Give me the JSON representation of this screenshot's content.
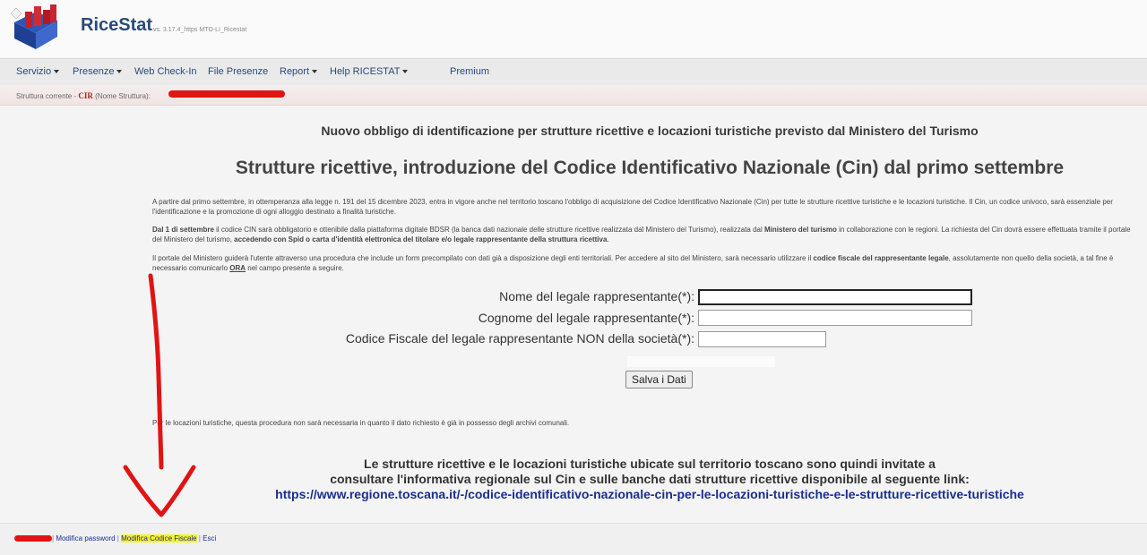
{
  "app": {
    "name": "RiceStat",
    "version": "vs. 3.17.4_https MTO-LI_Ricestat"
  },
  "nav": {
    "items": [
      {
        "label": "Servizio",
        "dropdown": true
      },
      {
        "label": "Presenze",
        "dropdown": true
      },
      {
        "label": "Web Check-In",
        "dropdown": false
      },
      {
        "label": "File Presenze",
        "dropdown": false
      },
      {
        "label": "Report",
        "dropdown": true
      },
      {
        "label": "Help RICESTAT",
        "dropdown": true
      },
      {
        "label": "Premium",
        "dropdown": false
      }
    ]
  },
  "structure": {
    "prefix": "Struttura corrente -",
    "code": "CIR",
    "name_label": "(Nome Struttura):"
  },
  "main": {
    "subtitle": "Nuovo obbligo di identificazione per strutture ricettive e locazioni turistiche previsto dal Ministero del Turismo",
    "title": "Strutture ricettive, introduzione del Codice Identificativo Nazionale (Cin) dal primo settembre",
    "p1": "A partire dal primo settembre, in ottemperanza alla legge n. 191 del 15 dicembre 2023, entra in vigore anche nel territorio toscano l'obbligo di acquisizione del Codice Identificativo Nazionale (Cin) per tutte le strutture ricettive turistiche e le locazioni turistiche. Il Cin, un codice univoco, sarà essenziale per l'identificazione e la promozione di ogni alloggio destinato a finalità turistiche.",
    "p2": {
      "b1": "Dal 1 di settembre",
      "t1": " il codice CIN sarà obbligatorio e ottenibile dalla piattaforma digitale BDSR (la banca dati nazionale delle strutture ricettive realizzata dal Ministero del Turismo), realizzata dal ",
      "b2": "Ministero del turismo",
      "t2": " in collaborazione con le regioni. La richiesta del Cin dovrà essere effettuata tramite il portale del Ministero del turismo, ",
      "b3": "accedendo con Spid o carta d'identità elettronica del titolare e/o legale rappresentante della struttura ricettiva",
      "t3": "."
    },
    "p3": {
      "t1": "Il portale del Ministero guiderà l'utente attraverso una procedura che include un form precompilato con dati già a disposizione degli enti territoriali. Per accedere al sito del Ministero, sarà necessario utilizzare il ",
      "b1": "codice fiscale del rappresentante legale",
      "t2": ", assolutamente non quello della società, a tal fine è necessario comunicarlo ",
      "u1": "ORA",
      "t3": " nel campo presente a seguire."
    }
  },
  "form": {
    "nome_label": "Nome del legale rappresentante(*):",
    "nome_value": "",
    "cognome_label": "Cognome del legale rappresentante(*):",
    "cognome_value": "",
    "cf_label": "Codice Fiscale del legale rappresentante NON della società(*):",
    "cf_value": "",
    "save_label": "Salva i Dati"
  },
  "note": "Per le locazioni turistiche, questa procedura non sarà necessaria in quanto il dato richiesto è già in possesso degli archivi comunali.",
  "bottom": {
    "line1": "Le strutture ricettive e le locazioni turistiche ubicate sul territorio toscano sono quindi invitate a",
    "line2": "consultare l'informativa regionale sul Cin e sulle banche dati strutture ricettive disponibile al seguente link:",
    "link": "https://www.regione.toscana.it/-/codice-identificativo-nazionale-cin-per-le-locazioni-turistiche-e-le-strutture-ricettive-turistiche"
  },
  "footer": {
    "sep": "|",
    "modifica_password": "Modifica password",
    "modifica_cf": "Modifica Codice Fiscale",
    "esci": "Esci"
  },
  "colors": {
    "accent": "#2b4a78",
    "link": "#1a2d8f",
    "annotation": "#e11414",
    "highlight": "#f5f22b"
  }
}
